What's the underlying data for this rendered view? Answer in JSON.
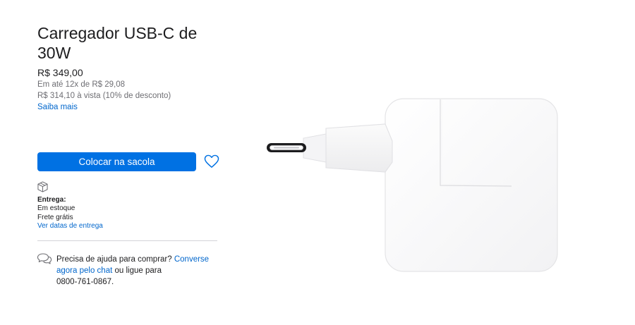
{
  "product": {
    "title": "Carregador USB-C de 30W",
    "price": "R$ 349,00",
    "installments": "Em até 12x de R$ 29,08",
    "cash_price": "R$ 314,10 à vista (10% de desconto)",
    "learn_more": "Saiba mais"
  },
  "actions": {
    "add_to_bag": "Colocar na sacola",
    "favorite_icon": "heart-icon"
  },
  "delivery": {
    "icon": "box-icon",
    "title": "Entrega:",
    "stock": "Em estoque",
    "shipping": "Frete grátis",
    "dates_link": "Ver datas de entrega"
  },
  "help": {
    "icon": "chat-bubbles-icon",
    "text_before": "Precisa de ajuda para comprar? ",
    "chat_link": "Converse agora pelo chat",
    "text_middle": " ou ligue para",
    "phone": "0800-761-0867."
  },
  "colors": {
    "accent": "#0071e3",
    "link": "#0066cc",
    "text": "#1d1d1f",
    "muted": "#6e6e73"
  }
}
